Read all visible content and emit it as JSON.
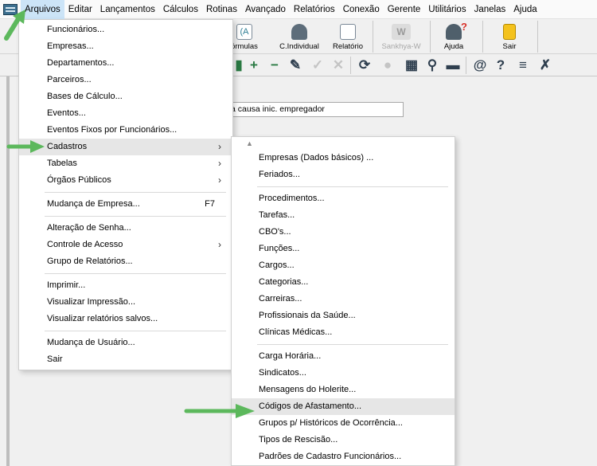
{
  "menubar": {
    "items": [
      {
        "label": "Arquivos",
        "active": true
      },
      {
        "label": "Editar"
      },
      {
        "label": "Lançamentos"
      },
      {
        "label": "Cálculos"
      },
      {
        "label": "Rotinas"
      },
      {
        "label": "Avançado"
      },
      {
        "label": "Relatórios"
      },
      {
        "label": "Conexão"
      },
      {
        "label": "Gerente"
      },
      {
        "label": "Utilitários"
      },
      {
        "label": "Janelas"
      },
      {
        "label": "Ajuda"
      }
    ]
  },
  "toolbar": {
    "buttons": [
      {
        "label": "órmulas",
        "icon": "formulas-icon"
      },
      {
        "label": "C.Individual",
        "icon": "individual-calc-icon"
      },
      {
        "label": "Relatório",
        "icon": "report-icon"
      },
      {
        "label": "Sankhya-W",
        "icon": "sankhya-w-icon",
        "disabled": true
      },
      {
        "label": "Ajuda",
        "icon": "help-user-icon"
      },
      {
        "label": "Sair",
        "icon": "exit-door-icon"
      }
    ]
  },
  "toolbar2": {
    "glyphs": [
      "+",
      "−",
      "✎",
      "✓",
      "✕",
      "⟳",
      "●",
      "▦",
      "⚲",
      "▬",
      "@",
      "?",
      "≡",
      "✗"
    ]
  },
  "form": {
    "field_value": "a causa inic. empregador"
  },
  "menu_arquivos": {
    "items": [
      {
        "type": "item",
        "label": "Funcionários..."
      },
      {
        "type": "item",
        "label": "Empresas..."
      },
      {
        "type": "item",
        "label": "Departamentos..."
      },
      {
        "type": "item",
        "label": "Parceiros..."
      },
      {
        "type": "item",
        "label": "Bases de Cálculo..."
      },
      {
        "type": "item",
        "label": "Eventos..."
      },
      {
        "type": "item",
        "label": "Eventos Fixos por Funcionários..."
      },
      {
        "type": "item",
        "label": "Cadastros",
        "submenu": true,
        "highlighted": true
      },
      {
        "type": "item",
        "label": "Tabelas",
        "submenu": true
      },
      {
        "type": "item",
        "label": "Órgãos Públicos",
        "submenu": true
      },
      {
        "type": "sep"
      },
      {
        "type": "item",
        "label": "Mudança de Empresa...",
        "shortcut": "F7"
      },
      {
        "type": "sep"
      },
      {
        "type": "item",
        "label": "Alteração de Senha..."
      },
      {
        "type": "item",
        "label": "Controle de Acesso",
        "submenu": true
      },
      {
        "type": "item",
        "label": "Grupo de Relatórios..."
      },
      {
        "type": "sep"
      },
      {
        "type": "item",
        "label": "Imprimir..."
      },
      {
        "type": "item",
        "label": "Visualizar Impressão..."
      },
      {
        "type": "item",
        "label": "Visualizar relatórios salvos..."
      },
      {
        "type": "sep"
      },
      {
        "type": "item",
        "label": "Mudança de Usuário..."
      },
      {
        "type": "item",
        "label": "Sair"
      }
    ]
  },
  "menu_cadastros": {
    "scroll_up": "▲",
    "items": [
      {
        "type": "item",
        "label": "Empresas (Dados básicos) ..."
      },
      {
        "type": "item",
        "label": "Feriados..."
      },
      {
        "type": "sep"
      },
      {
        "type": "item",
        "label": "Procedimentos..."
      },
      {
        "type": "item",
        "label": "Tarefas..."
      },
      {
        "type": "item",
        "label": "CBO's..."
      },
      {
        "type": "item",
        "label": "Funções..."
      },
      {
        "type": "item",
        "label": "Cargos..."
      },
      {
        "type": "item",
        "label": "Categorias..."
      },
      {
        "type": "item",
        "label": "Carreiras..."
      },
      {
        "type": "item",
        "label": "Profissionais da Saúde..."
      },
      {
        "type": "item",
        "label": "Clínicas Médicas..."
      },
      {
        "type": "sep"
      },
      {
        "type": "item",
        "label": "Carga Horária..."
      },
      {
        "type": "item",
        "label": "Sindicatos..."
      },
      {
        "type": "item",
        "label": "Mensagens do Holerite..."
      },
      {
        "type": "item",
        "label": "Códigos de Afastamento...",
        "highlighted": true
      },
      {
        "type": "item",
        "label": "Grupos p/ Históricos de Ocorrência..."
      },
      {
        "type": "item",
        "label": "Tipos de Rescisão..."
      },
      {
        "type": "item",
        "label": "Padrões de Cadastro Funcionários..."
      }
    ]
  },
  "colors": {
    "highlight": "#e6e6e6",
    "menubar_active": "#cce4f7",
    "annotation_arrow": "#5cb85c"
  }
}
